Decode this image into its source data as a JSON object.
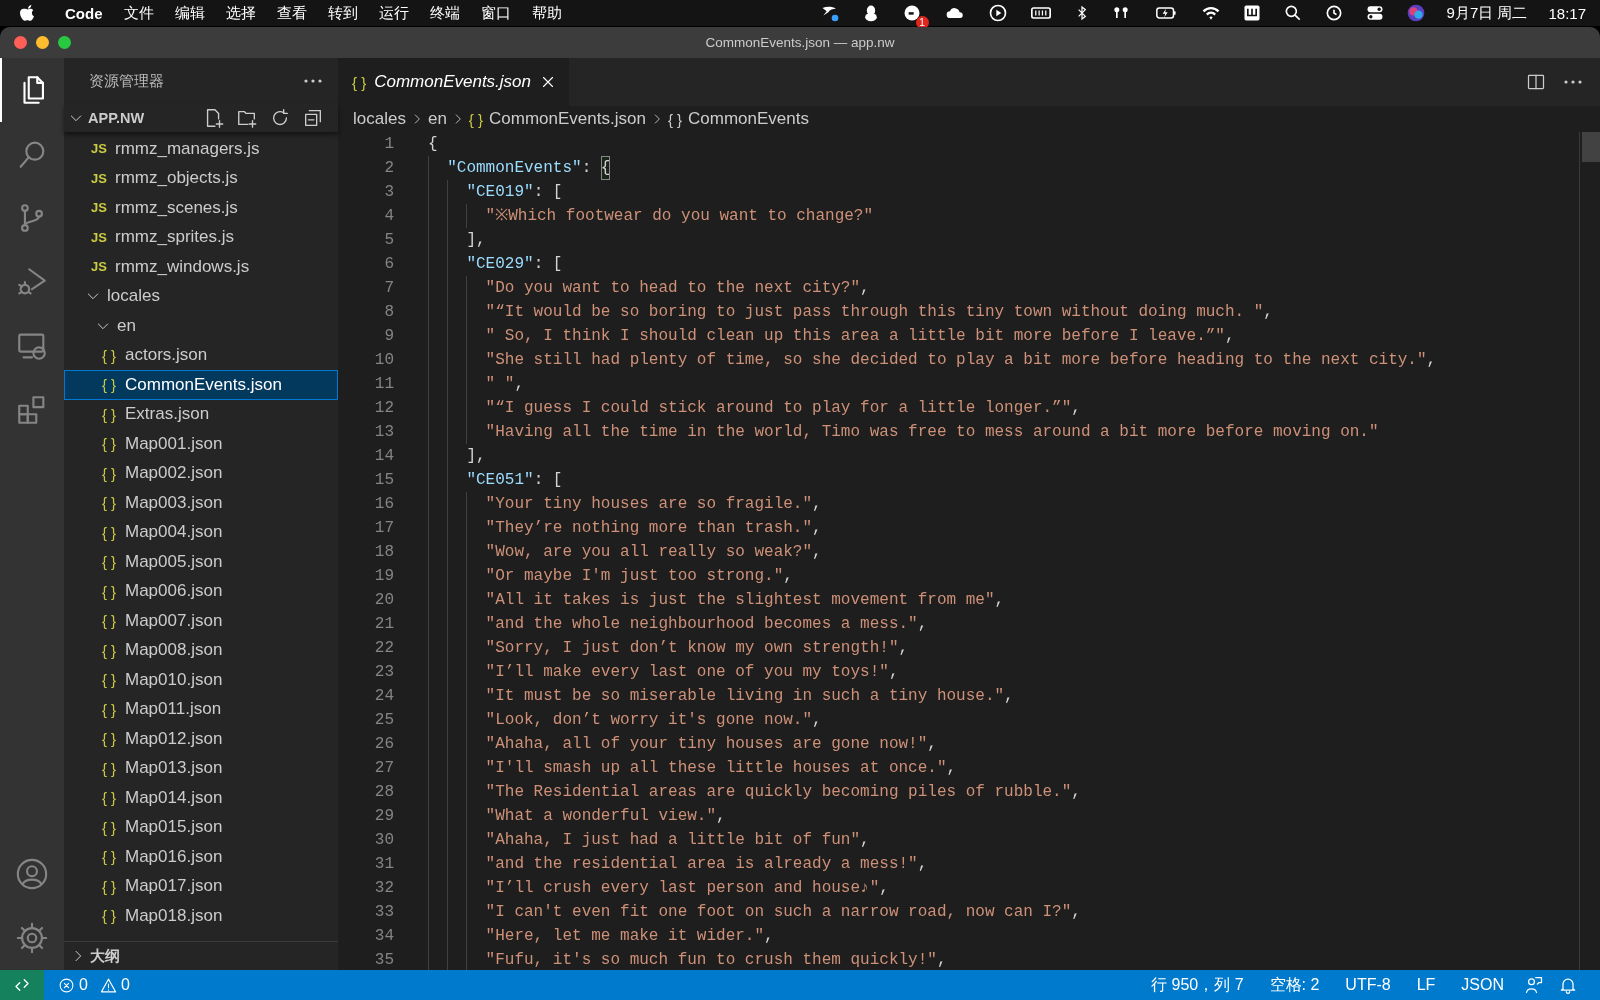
{
  "menu_bar": {
    "app_name": "Code",
    "menus": [
      "文件",
      "编辑",
      "选择",
      "查看",
      "转到",
      "运行",
      "终端",
      "窗口",
      "帮助"
    ],
    "notification_badge": "1",
    "date": "9月7日 周二",
    "time": "18:17"
  },
  "window": {
    "title": "CommonEvents.json — app.nw"
  },
  "activity_bar": {
    "items": [
      {
        "kind": "explorer",
        "selected": true
      },
      {
        "kind": "search",
        "selected": false
      },
      {
        "kind": "source-control",
        "selected": false
      },
      {
        "kind": "run-debug",
        "selected": false
      },
      {
        "kind": "remote",
        "selected": false
      },
      {
        "kind": "extensions",
        "selected": false
      }
    ],
    "bottom_items": [
      {
        "kind": "account"
      },
      {
        "kind": "settings"
      }
    ]
  },
  "explorer": {
    "title": "资源管理器",
    "section": {
      "title": "APP.NW",
      "expanded": true
    },
    "tree": [
      {
        "kind": "file",
        "icon": "JS",
        "label": "rmmz_managers.js",
        "selected": false
      },
      {
        "kind": "file",
        "icon": "JS",
        "label": "rmmz_objects.js",
        "selected": false
      },
      {
        "kind": "file",
        "icon": "JS",
        "label": "rmmz_scenes.js",
        "selected": false
      },
      {
        "kind": "file",
        "icon": "JS",
        "label": "rmmz_sprites.js",
        "selected": false
      },
      {
        "kind": "file",
        "icon": "JS",
        "label": "rmmz_windows.js",
        "selected": false
      },
      {
        "kind": "folder",
        "label": "locales",
        "expanded": true,
        "selected": false,
        "children": [
          {
            "kind": "folder",
            "label": "en",
            "expanded": true,
            "selected": false,
            "children": [
              {
                "kind": "file",
                "icon": "{ }",
                "label": "actors.json",
                "selected": false
              },
              {
                "kind": "file",
                "icon": "{ }",
                "label": "CommonEvents.json",
                "selected": true
              },
              {
                "kind": "file",
                "icon": "{ }",
                "label": "Extras.json",
                "selected": false
              },
              {
                "kind": "file",
                "icon": "{ }",
                "label": "Map001.json",
                "selected": false
              },
              {
                "kind": "file",
                "icon": "{ }",
                "label": "Map002.json",
                "selected": false
              },
              {
                "kind": "file",
                "icon": "{ }",
                "label": "Map003.json",
                "selected": false
              },
              {
                "kind": "file",
                "icon": "{ }",
                "label": "Map004.json",
                "selected": false
              },
              {
                "kind": "file",
                "icon": "{ }",
                "label": "Map005.json",
                "selected": false
              },
              {
                "kind": "file",
                "icon": "{ }",
                "label": "Map006.json",
                "selected": false
              },
              {
                "kind": "file",
                "icon": "{ }",
                "label": "Map007.json",
                "selected": false
              },
              {
                "kind": "file",
                "icon": "{ }",
                "label": "Map008.json",
                "selected": false
              },
              {
                "kind": "file",
                "icon": "{ }",
                "label": "Map010.json",
                "selected": false
              },
              {
                "kind": "file",
                "icon": "{ }",
                "label": "Map011.json",
                "selected": false
              },
              {
                "kind": "file",
                "icon": "{ }",
                "label": "Map012.json",
                "selected": false
              },
              {
                "kind": "file",
                "icon": "{ }",
                "label": "Map013.json",
                "selected": false
              },
              {
                "kind": "file",
                "icon": "{ }",
                "label": "Map014.json",
                "selected": false
              },
              {
                "kind": "file",
                "icon": "{ }",
                "label": "Map015.json",
                "selected": false
              },
              {
                "kind": "file",
                "icon": "{ }",
                "label": "Map016.json",
                "selected": false
              },
              {
                "kind": "file",
                "icon": "{ }",
                "label": "Map017.json",
                "selected": false
              },
              {
                "kind": "file",
                "icon": "{ }",
                "label": "Map018.json",
                "selected": false
              }
            ]
          }
        ]
      }
    ],
    "outline": {
      "title": "大纲",
      "expanded": false
    }
  },
  "editor": {
    "tabs": [
      {
        "icon": "{ }",
        "label": "CommonEvents.json",
        "selected": true,
        "preview": true
      }
    ],
    "breadcrumbs": [
      {
        "kind": "folder",
        "label": "locales"
      },
      {
        "kind": "folder",
        "label": "en"
      },
      {
        "kind": "file",
        "icon": "{ }",
        "label": "CommonEvents.json"
      },
      {
        "kind": "symbol",
        "icon": "{ }",
        "label": "CommonEvents"
      }
    ],
    "lines": [
      {
        "n": "1",
        "tokens": [
          {
            "kind": "punct",
            "text": "{"
          }
        ]
      },
      {
        "n": "2",
        "tokens": [
          {
            "kind": "key",
            "text": "  \"CommonEvents\""
          },
          {
            "kind": "punct",
            "text": ": "
          },
          {
            "kind": "match",
            "text": "{"
          }
        ]
      },
      {
        "n": "3",
        "tokens": [
          {
            "kind": "key",
            "text": "    \"CE019\""
          },
          {
            "kind": "punct",
            "text": ": ["
          }
        ]
      },
      {
        "n": "4",
        "tokens": [
          {
            "kind": "string",
            "text": "      \"※Which footwear do you want to change?\""
          }
        ]
      },
      {
        "n": "5",
        "tokens": [
          {
            "kind": "punct",
            "text": "    ],"
          }
        ]
      },
      {
        "n": "6",
        "tokens": [
          {
            "kind": "key",
            "text": "    \"CE029\""
          },
          {
            "kind": "punct",
            "text": ": ["
          }
        ]
      },
      {
        "n": "7",
        "tokens": [
          {
            "kind": "string",
            "text": "      \"Do you want to head to the next city?\""
          },
          {
            "kind": "punct",
            "text": ","
          }
        ]
      },
      {
        "n": "8",
        "tokens": [
          {
            "kind": "string",
            "text": "      \"“It would be so boring to just pass through this tiny town without doing much. \""
          },
          {
            "kind": "punct",
            "text": ","
          }
        ]
      },
      {
        "n": "9",
        "tokens": [
          {
            "kind": "string",
            "text": "      \" So, I think I should clean up this area a little bit more before I leave.”\""
          },
          {
            "kind": "punct",
            "text": ","
          }
        ]
      },
      {
        "n": "10",
        "tokens": [
          {
            "kind": "string",
            "text": "      \"She still had plenty of time, so she decided to play a bit more before heading to the next city.\""
          },
          {
            "kind": "punct",
            "text": ","
          }
        ]
      },
      {
        "n": "11",
        "tokens": [
          {
            "kind": "string",
            "text": "      \" \""
          },
          {
            "kind": "punct",
            "text": ","
          }
        ]
      },
      {
        "n": "12",
        "tokens": [
          {
            "kind": "string",
            "text": "      \"“I guess I could stick around to play for a little longer.”\""
          },
          {
            "kind": "punct",
            "text": ","
          }
        ]
      },
      {
        "n": "13",
        "tokens": [
          {
            "kind": "string",
            "text": "      \"Having all the time in the world, Timo was free to mess around a bit more before moving on.\""
          }
        ]
      },
      {
        "n": "14",
        "tokens": [
          {
            "kind": "punct",
            "text": "    ],"
          }
        ]
      },
      {
        "n": "15",
        "tokens": [
          {
            "kind": "key",
            "text": "    \"CE051\""
          },
          {
            "kind": "punct",
            "text": ": ["
          }
        ]
      },
      {
        "n": "16",
        "tokens": [
          {
            "kind": "string",
            "text": "      \"Your tiny houses are so fragile.\""
          },
          {
            "kind": "punct",
            "text": ","
          }
        ]
      },
      {
        "n": "17",
        "tokens": [
          {
            "kind": "string",
            "text": "      \"They’re nothing more than trash.\""
          },
          {
            "kind": "punct",
            "text": ","
          }
        ]
      },
      {
        "n": "18",
        "tokens": [
          {
            "kind": "string",
            "text": "      \"Wow, are you all really so weak?\""
          },
          {
            "kind": "punct",
            "text": ","
          }
        ]
      },
      {
        "n": "19",
        "tokens": [
          {
            "kind": "string",
            "text": "      \"Or maybe I'm just too strong.\""
          },
          {
            "kind": "punct",
            "text": ","
          }
        ]
      },
      {
        "n": "20",
        "tokens": [
          {
            "kind": "string",
            "text": "      \"All it takes is just the slightest movement from me\""
          },
          {
            "kind": "punct",
            "text": ","
          }
        ]
      },
      {
        "n": "21",
        "tokens": [
          {
            "kind": "string",
            "text": "      \"and the whole neighbourhood becomes a mess.\""
          },
          {
            "kind": "punct",
            "text": ","
          }
        ]
      },
      {
        "n": "22",
        "tokens": [
          {
            "kind": "string",
            "text": "      \"Sorry, I just don’t know my own strength!\""
          },
          {
            "kind": "punct",
            "text": ","
          }
        ]
      },
      {
        "n": "23",
        "tokens": [
          {
            "kind": "string",
            "text": "      \"I’ll make every last one of you my toys!\""
          },
          {
            "kind": "punct",
            "text": ","
          }
        ]
      },
      {
        "n": "24",
        "tokens": [
          {
            "kind": "string",
            "text": "      \"It must be so miserable living in such a tiny house.\""
          },
          {
            "kind": "punct",
            "text": ","
          }
        ]
      },
      {
        "n": "25",
        "tokens": [
          {
            "kind": "string",
            "text": "      \"Look, don’t worry it's gone now.\""
          },
          {
            "kind": "punct",
            "text": ","
          }
        ]
      },
      {
        "n": "26",
        "tokens": [
          {
            "kind": "string",
            "text": "      \"Ahaha, all of your tiny houses are gone now!\""
          },
          {
            "kind": "punct",
            "text": ","
          }
        ]
      },
      {
        "n": "27",
        "tokens": [
          {
            "kind": "string",
            "text": "      \"I'll smash up all these little houses at once.\""
          },
          {
            "kind": "punct",
            "text": ","
          }
        ]
      },
      {
        "n": "28",
        "tokens": [
          {
            "kind": "string",
            "text": "      \"The Residential areas are quickly becoming piles of rubble.\""
          },
          {
            "kind": "punct",
            "text": ","
          }
        ]
      },
      {
        "n": "29",
        "tokens": [
          {
            "kind": "string",
            "text": "      \"What a wonderful view.\""
          },
          {
            "kind": "punct",
            "text": ","
          }
        ]
      },
      {
        "n": "30",
        "tokens": [
          {
            "kind": "string",
            "text": "      \"Ahaha, I just had a little bit of fun\""
          },
          {
            "kind": "punct",
            "text": ","
          }
        ]
      },
      {
        "n": "31",
        "tokens": [
          {
            "kind": "string",
            "text": "      \"and the residential area is already a mess!\""
          },
          {
            "kind": "punct",
            "text": ","
          }
        ]
      },
      {
        "n": "32",
        "tokens": [
          {
            "kind": "string",
            "text": "      \"I’ll crush every last person and house♪\""
          },
          {
            "kind": "punct",
            "text": ","
          }
        ]
      },
      {
        "n": "33",
        "tokens": [
          {
            "kind": "string",
            "text": "      \"I can't even fit one foot on such a narrow road, now can I?\""
          },
          {
            "kind": "punct",
            "text": ","
          }
        ]
      },
      {
        "n": "34",
        "tokens": [
          {
            "kind": "string",
            "text": "      \"Here, let me make it wider.\""
          },
          {
            "kind": "punct",
            "text": ","
          }
        ]
      },
      {
        "n": "35",
        "tokens": [
          {
            "kind": "string",
            "text": "      \"Fufu, it's so much fun to crush them quickly!\""
          },
          {
            "kind": "punct",
            "text": ","
          }
        ]
      }
    ]
  },
  "status_bar": {
    "left": [
      {
        "kind": "errors",
        "text": "0"
      },
      {
        "kind": "warnings",
        "text": "0"
      }
    ],
    "right": [
      {
        "kind": "text",
        "text": "行 950，列 7"
      },
      {
        "kind": "text",
        "text": "空格: 2"
      },
      {
        "kind": "text",
        "text": "UTF-8"
      },
      {
        "kind": "text",
        "text": "LF"
      },
      {
        "kind": "text",
        "text": "JSON"
      },
      {
        "kind": "feedback"
      },
      {
        "kind": "notifications"
      }
    ]
  }
}
